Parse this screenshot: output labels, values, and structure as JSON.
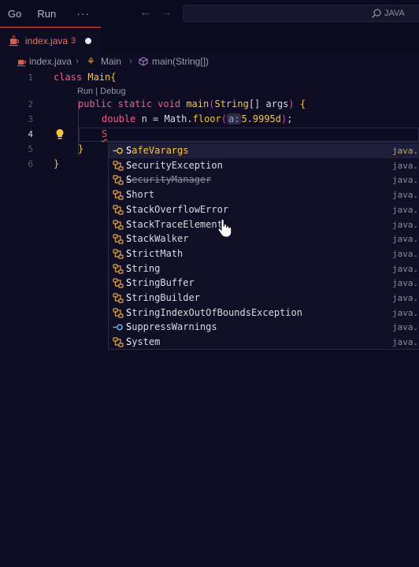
{
  "menu": {
    "go": "Go",
    "run": "Run",
    "more": "···"
  },
  "search": {
    "text": "JAVA"
  },
  "tab": {
    "label": "index.java",
    "badge": "3"
  },
  "breadcrumb": {
    "file": "index.java",
    "class": "Main",
    "method": "main(String[])"
  },
  "editor": {
    "line_numbers": [
      "1",
      "2",
      "3",
      "4",
      "5",
      "6"
    ],
    "codelens": "Run | Debug",
    "line1": {
      "kw": "class",
      "name": "Main",
      "brace": "{"
    },
    "line2": {
      "kw1": "public",
      "kw2": "static",
      "kw3": "void",
      "fn": "main",
      "paren_open": "(",
      "type": "String",
      "args": "[] args",
      "paren_close": ")",
      "brace": "{"
    },
    "line3": {
      "kw": "double",
      "var": "n = Math.",
      "fn": "floor",
      "paren_open": "(",
      "hint": "a:",
      "num": "5.9995d",
      "paren_close": ")",
      "end": ";"
    },
    "line4": {
      "typed": "S"
    },
    "line5": {
      "brace": "}"
    },
    "line6": {
      "brace": "}"
    }
  },
  "suggestions": [
    {
      "match": "S",
      "rest": "afeVarargs",
      "detail": "java.lang",
      "kind": "annotation",
      "selected": true
    },
    {
      "match": "S",
      "rest": "ecurityException",
      "detail": "java.lang",
      "kind": "class"
    },
    {
      "match": "S",
      "rest": "ecurityManager",
      "detail": "java.lang",
      "kind": "class",
      "deprecated": true
    },
    {
      "match": "S",
      "rest": "hort",
      "detail": "java.lang",
      "kind": "class"
    },
    {
      "match": "S",
      "rest": "tackOverflowError",
      "detail": "java.lang",
      "kind": "class"
    },
    {
      "match": "S",
      "rest": "tackTraceElement",
      "detail": "java.lang",
      "kind": "class"
    },
    {
      "match": "S",
      "rest": "tackWalker",
      "detail": "java.lang",
      "kind": "class"
    },
    {
      "match": "S",
      "rest": "trictMath",
      "detail": "java.lang",
      "kind": "class"
    },
    {
      "match": "S",
      "rest": "tring",
      "detail": "java.lang",
      "kind": "class"
    },
    {
      "match": "S",
      "rest": "tringBuffer",
      "detail": "java.lang",
      "kind": "class"
    },
    {
      "match": "S",
      "rest": "tringBuilder",
      "detail": "java.lang",
      "kind": "class"
    },
    {
      "match": "S",
      "rest": "tringIndexOutOfBoundsException",
      "detail": "java.lang",
      "kind": "class"
    },
    {
      "match": "S",
      "rest": "uppressWarnings",
      "detail": "java.lang",
      "kind": "annotation"
    },
    {
      "match": "S",
      "rest": "ystem",
      "detail": "java.lang",
      "kind": "class"
    }
  ],
  "colors": {
    "accent": "#f5c542",
    "keyword": "#f05e8c",
    "error": "#e05a47",
    "background": "#0d0c22"
  }
}
